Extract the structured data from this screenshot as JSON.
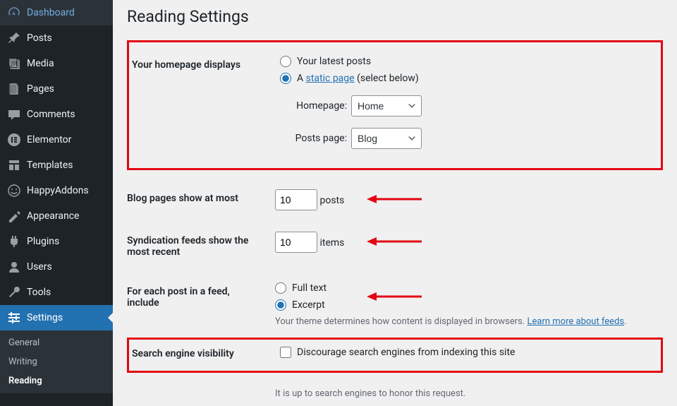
{
  "sidebar": {
    "items": [
      {
        "label": "Dashboard",
        "icon": "dashboard"
      },
      {
        "label": "Posts",
        "icon": "pin"
      },
      {
        "label": "Media",
        "icon": "media"
      },
      {
        "label": "Pages",
        "icon": "pages"
      },
      {
        "label": "Comments",
        "icon": "comments"
      },
      {
        "label": "Elementor",
        "icon": "elementor"
      },
      {
        "label": "Templates",
        "icon": "templates"
      },
      {
        "label": "HappyAddons",
        "icon": "happy"
      },
      {
        "label": "Appearance",
        "icon": "appearance"
      },
      {
        "label": "Plugins",
        "icon": "plugins"
      },
      {
        "label": "Users",
        "icon": "users"
      },
      {
        "label": "Tools",
        "icon": "tools"
      },
      {
        "label": "Settings",
        "icon": "settings"
      }
    ],
    "sub": [
      {
        "label": "General"
      },
      {
        "label": "Writing"
      },
      {
        "label": "Reading"
      }
    ]
  },
  "page": {
    "title": "Reading Settings",
    "homepage": {
      "label": "Your homepage displays",
      "opt_latest": "Your latest posts",
      "opt_static_prefix": "A ",
      "opt_static_link": "static page",
      "opt_static_suffix": " (select below)",
      "homepage_label": "Homepage:",
      "homepage_value": "Home",
      "posts_label": "Posts page:",
      "posts_value": "Blog"
    },
    "blog_pages": {
      "label": "Blog pages show at most",
      "value": "10",
      "suffix": "posts"
    },
    "syndication": {
      "label": "Syndication feeds show the most recent",
      "value": "10",
      "suffix": "items"
    },
    "feed_content": {
      "label": "For each post in a feed, include",
      "opt_full": "Full text",
      "opt_excerpt": "Excerpt",
      "desc_prefix": "Your theme determines how content is displayed in browsers. ",
      "desc_link": "Learn more about feeds"
    },
    "search": {
      "label": "Search engine visibility",
      "checkbox": "Discourage search engines from indexing this site",
      "desc": "It is up to search engines to honor this request."
    }
  }
}
